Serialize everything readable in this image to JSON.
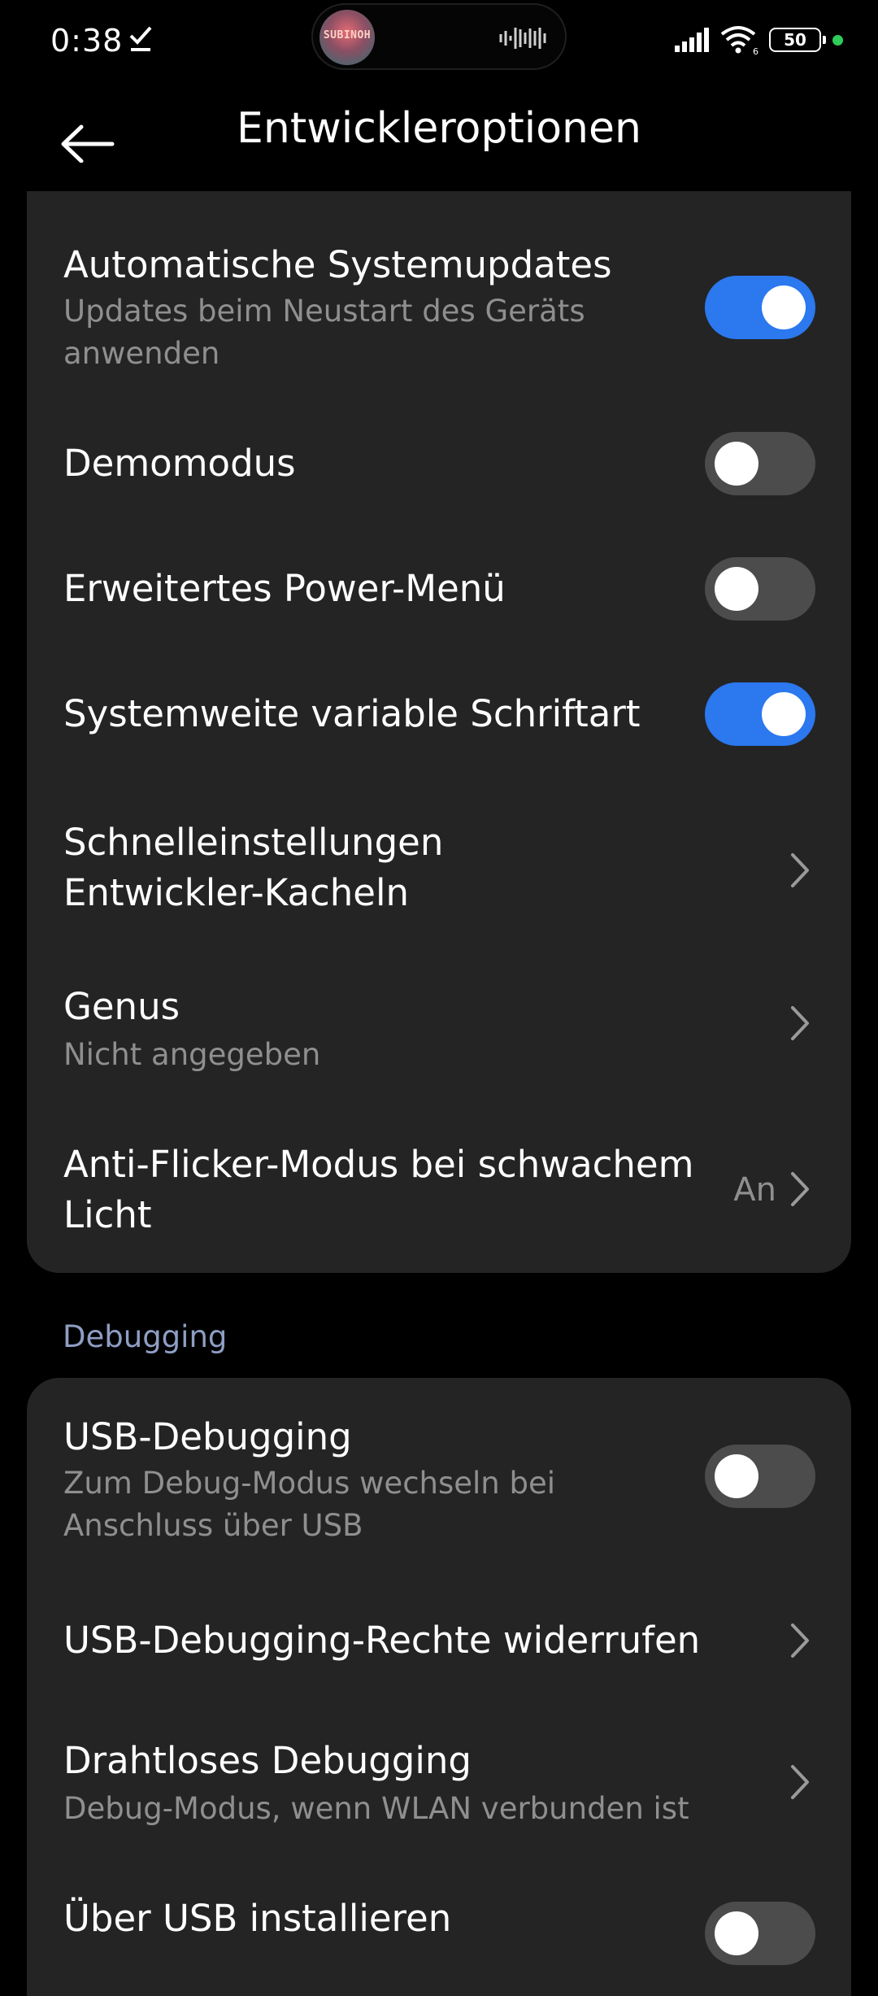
{
  "status_bar": {
    "time": "0:38",
    "battery": "50",
    "island_art_text": "SUBINOH"
  },
  "header": {
    "title": "Entwickleroptionen"
  },
  "section1": {
    "items": [
      {
        "title": "Automatische Systemupdates",
        "subtitle_line1": "Updates beim Neustart des Geräts",
        "subtitle_line2": "anwenden",
        "type": "toggle",
        "on": true
      },
      {
        "title": "Demomodus",
        "type": "toggle",
        "on": false
      },
      {
        "title": "Erweitertes Power-Menü",
        "type": "toggle",
        "on": false
      },
      {
        "title": "Systemweite variable Schriftart",
        "type": "toggle",
        "on": true
      },
      {
        "title_line1": "Schnelleinstellungen",
        "title_line2": "Entwickler-Kacheln",
        "type": "chevron"
      },
      {
        "title": "Genus",
        "subtitle": "Nicht angegeben",
        "type": "chevron"
      },
      {
        "title_line1": "Anti-Flicker-Modus bei schwachem",
        "title_line2": "Licht",
        "value": "An",
        "type": "chevron"
      }
    ]
  },
  "section2": {
    "header": "Debugging",
    "items": [
      {
        "title": "USB-Debugging",
        "subtitle_line1": "Zum Debug-Modus wechseln bei",
        "subtitle_line2": "Anschluss über USB",
        "type": "toggle",
        "on": false
      },
      {
        "title": "USB-Debugging-Rechte widerrufen",
        "type": "chevron"
      },
      {
        "title": "Drahtloses Debugging",
        "subtitle": "Debug-Modus, wenn WLAN verbunden ist",
        "type": "chevron"
      },
      {
        "title": "Über USB installieren",
        "type": "toggle",
        "on": false
      }
    ]
  },
  "colors": {
    "background": "#000000",
    "card": "#242424",
    "accent": "#2b78ef",
    "toggle_off": "#4c4c4c",
    "subtitle": "#8f8f8f",
    "section_header": "#8e9ec4"
  },
  "icons": [
    "check-icon",
    "signal-icon",
    "wifi-icon",
    "battery-icon",
    "back-arrow-icon",
    "chevron-right-icon",
    "audio-wave-icon"
  ]
}
